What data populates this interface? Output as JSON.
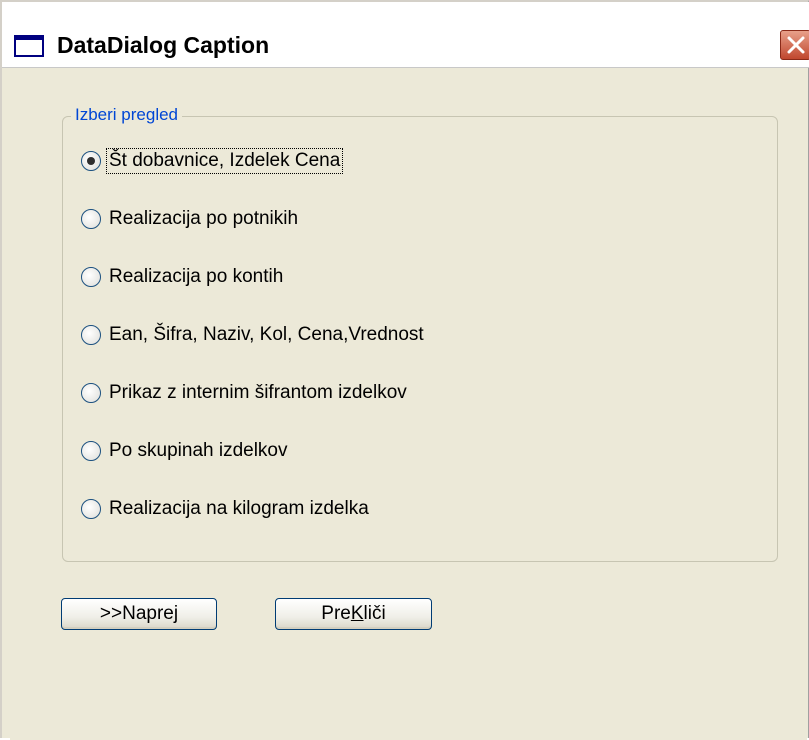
{
  "window": {
    "title": "DataDialog Caption"
  },
  "group": {
    "legend": "Izberi pregled",
    "options": [
      {
        "label": "Št dobavnice, Izdelek Cena",
        "checked": true
      },
      {
        "label": "Realizacija po potnikih",
        "checked": false
      },
      {
        "label": "Realizacija po kontih",
        "checked": false
      },
      {
        "label": "Ean, Šifra, Naziv, Kol, Cena,Vrednost",
        "checked": false
      },
      {
        "label": "Prikaz z internim šifrantom izdelkov",
        "checked": false
      },
      {
        "label": "Po skupinah izdelkov",
        "checked": false
      },
      {
        "label": "Realizacija na kilogram izdelka",
        "checked": false
      }
    ]
  },
  "buttons": {
    "next_label": ">>Naprej",
    "cancel_prefix": "Pre",
    "cancel_mnemonic": "K",
    "cancel_suffix": "liči"
  },
  "colors": {
    "legend": "#0046d5",
    "close_button": "#c0472e"
  }
}
